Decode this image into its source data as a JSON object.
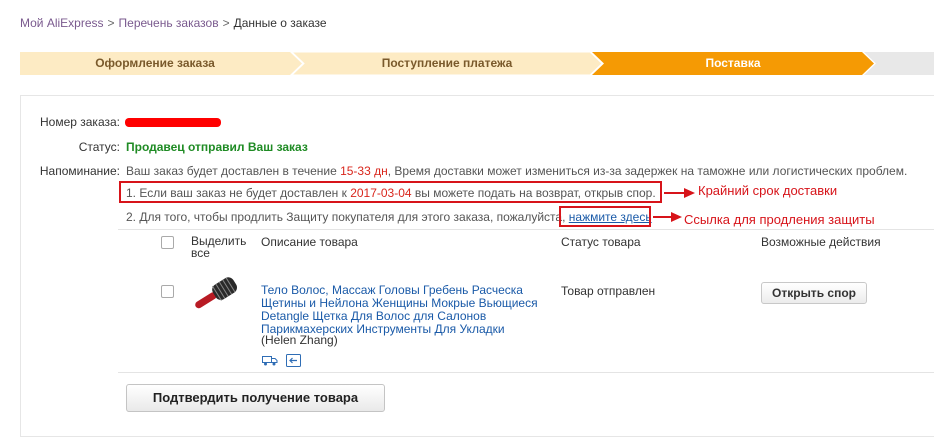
{
  "breadcrumb": {
    "items": [
      "Мой AliExpress",
      "Перечень заказов",
      "Данные о заказе"
    ],
    "separator": ">"
  },
  "steps": [
    {
      "label": "Оформление заказа",
      "state": "done"
    },
    {
      "label": "Поступление платежа",
      "state": "done"
    },
    {
      "label": "Поставка",
      "state": "active"
    }
  ],
  "colors": {
    "step_done": "#fdebc4",
    "step_active": "#f59a04",
    "step_pending": "#e8e8e8",
    "highlight": "#d7141a",
    "status_green": "#1f8b24",
    "link": "#1a5aa8"
  },
  "order": {
    "number_label": "Номер заказа:",
    "status_label": "Статус:",
    "status_value": "Продавец отправил Ваш заказ",
    "reminder_label": "Напоминание:",
    "reminder_prefix": "Ваш заказ будет доставлен в течение ",
    "reminder_days": "15-33 дн",
    "reminder_suffix": ", Время доставки может измениться из-за задержек на таможне или логистических проблем.",
    "note1_prefix": "1. Если ваш заказ не будет доставлен к ",
    "note1_date": "2017-03-04",
    "note1_suffix": " вы можете подать на возврат, открыв спор.",
    "note2_text": "2. Для того, чтобы продлить Защиту покупателя для этого заказа, пожалуйста, ",
    "note2_link": "нажмите здесь"
  },
  "annotations": {
    "deadline": "Крайний срок доставки",
    "protection": "Ссылка для продления защиты"
  },
  "table": {
    "headers": {
      "select": "Выделить все",
      "description": "Описание товара",
      "status": "Статус товара",
      "actions": "Возможные действия"
    },
    "rows": [
      {
        "product": "Тело Волос, Массаж Головы Гребень Расческа Щетины и Нейлона Женщины Мокрые Вьющиеся Detangle Щетка Для Волос для Салонов Парикмахерских Инструменты Для Укладки",
        "seller": "(Helen Zhang)",
        "status": "Товар отправлен",
        "action": "Открыть спор",
        "icons": [
          "shipping-icon",
          "return-icon"
        ]
      }
    ]
  },
  "confirm_button": "Подтвердить получение товара"
}
